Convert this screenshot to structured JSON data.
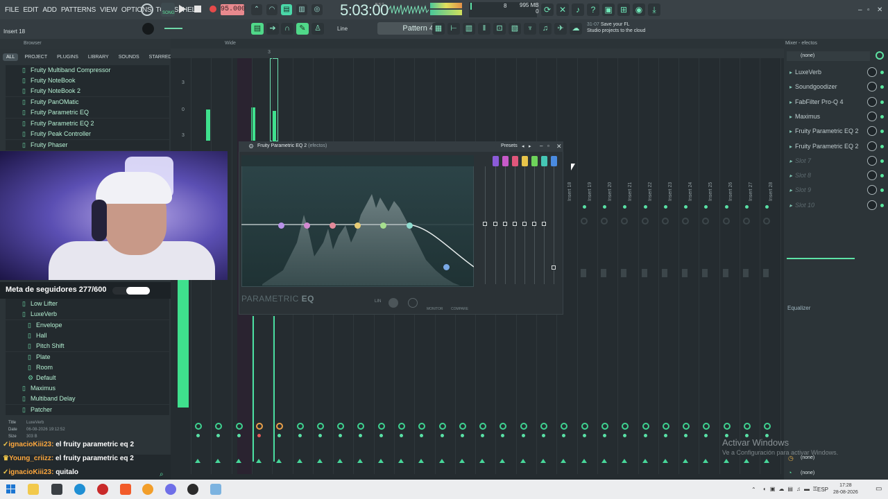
{
  "menu": [
    "FILE",
    "EDIT",
    "ADD",
    "PATTERNS",
    "VIEW",
    "OPTIONS",
    "TOOLS",
    "HELP"
  ],
  "transport": {
    "song_label": "SONG",
    "tempo": "95.000",
    "time": "5:03:00",
    "time_sub": "B:S:T",
    "cpu": "8",
    "mem_top": "995 MB",
    "mem_bottom": "0"
  },
  "toolbar2": {
    "insert_label": "Insert 18",
    "line_mode": "Line",
    "pattern": "Pattern 4",
    "hint_num": "31-07",
    "hint_line1": "Save your FL",
    "hint_line2": "Studio projects to the cloud"
  },
  "browser": {
    "title": "Browser",
    "tabs": [
      "ALL",
      "PROJECT",
      "PLUGINS",
      "LIBRARY",
      "SOUNDS",
      "STARRED"
    ],
    "items_top": [
      "Fruity Multiband Compressor",
      "Fruity NoteBook",
      "Fruity NoteBook 2",
      "Fruity PanOMatic",
      "Fruity Parametric EQ",
      "Fruity Parametric EQ 2",
      "Fruity Peak Controller",
      "Fruity Phaser"
    ],
    "items_bottom": [
      "Low Lifter",
      "LuxeVerb"
    ],
    "sub_items": [
      "Envelope",
      "Hall",
      "Pitch Shift",
      "Plate",
      "Room",
      "Default"
    ],
    "items_tail": [
      "Maximus",
      "Multiband Delay",
      "Patcher"
    ],
    "info": {
      "title_k": "Title",
      "title_v": "LuxeVerb",
      "date_k": "Date",
      "date_v": "06-08-2026 19:12:52",
      "size_k": "Size",
      "size_v": "303 B"
    }
  },
  "stream": {
    "goal": "Meta de seguidores 277/600",
    "goal_fraction": 0.4617,
    "chat": [
      {
        "user": "ignacioKiii23:",
        "msg": "el fruity parametric eq 2"
      },
      {
        "user": "Young_criizz:",
        "msg": "el fruity parametric eq 2"
      },
      {
        "user": "ignacioKiii23:",
        "msg": "quitalo"
      }
    ]
  },
  "mixer": {
    "view_mode": "Wide",
    "ruler_ticks": [
      "3"
    ],
    "db_labels": [
      "3",
      "0",
      "3"
    ],
    "insert_labels": [
      "Insert 18",
      "Insert 19",
      "Insert 20",
      "Insert 21",
      "Insert 22",
      "Insert 23",
      "Insert 24",
      "Insert 25",
      "Insert 26",
      "Insert 27",
      "Insert 28"
    ]
  },
  "eq": {
    "title": "Fruity Parametric EQ 2",
    "title_sub": "(efectos)",
    "presets": "Presets",
    "name_a": "PARAMETRIC",
    "name_b": "EQ",
    "monitor": "MONITOR",
    "compare": "COMPARE",
    "colors": [
      "#8b5bd8",
      "#c75ac9",
      "#e0567b",
      "#e8c44a",
      "#6ed35a",
      "#45c7b5",
      "#4a8be0"
    ]
  },
  "right_panel": {
    "title": "Mixer - efectos",
    "input": "(none)",
    "slots": [
      "LuxeVerb",
      "Soundgoodizer",
      "FabFilter Pro-Q 4",
      "Maximus",
      "Fruity Parametric EQ 2",
      "Fruity Parametric EQ 2",
      "Slot 7",
      "Slot 8",
      "Slot 9",
      "Slot 10"
    ],
    "eq_label": "Equalizer",
    "out1": "(none)",
    "out2": "(none)"
  },
  "watermark": {
    "line1": "Activar Windows",
    "line2": "Ve a Configuración para activar Windows."
  },
  "taskbar": {
    "lang": "ESP",
    "time": "17:28",
    "date": "28-08-2026"
  }
}
